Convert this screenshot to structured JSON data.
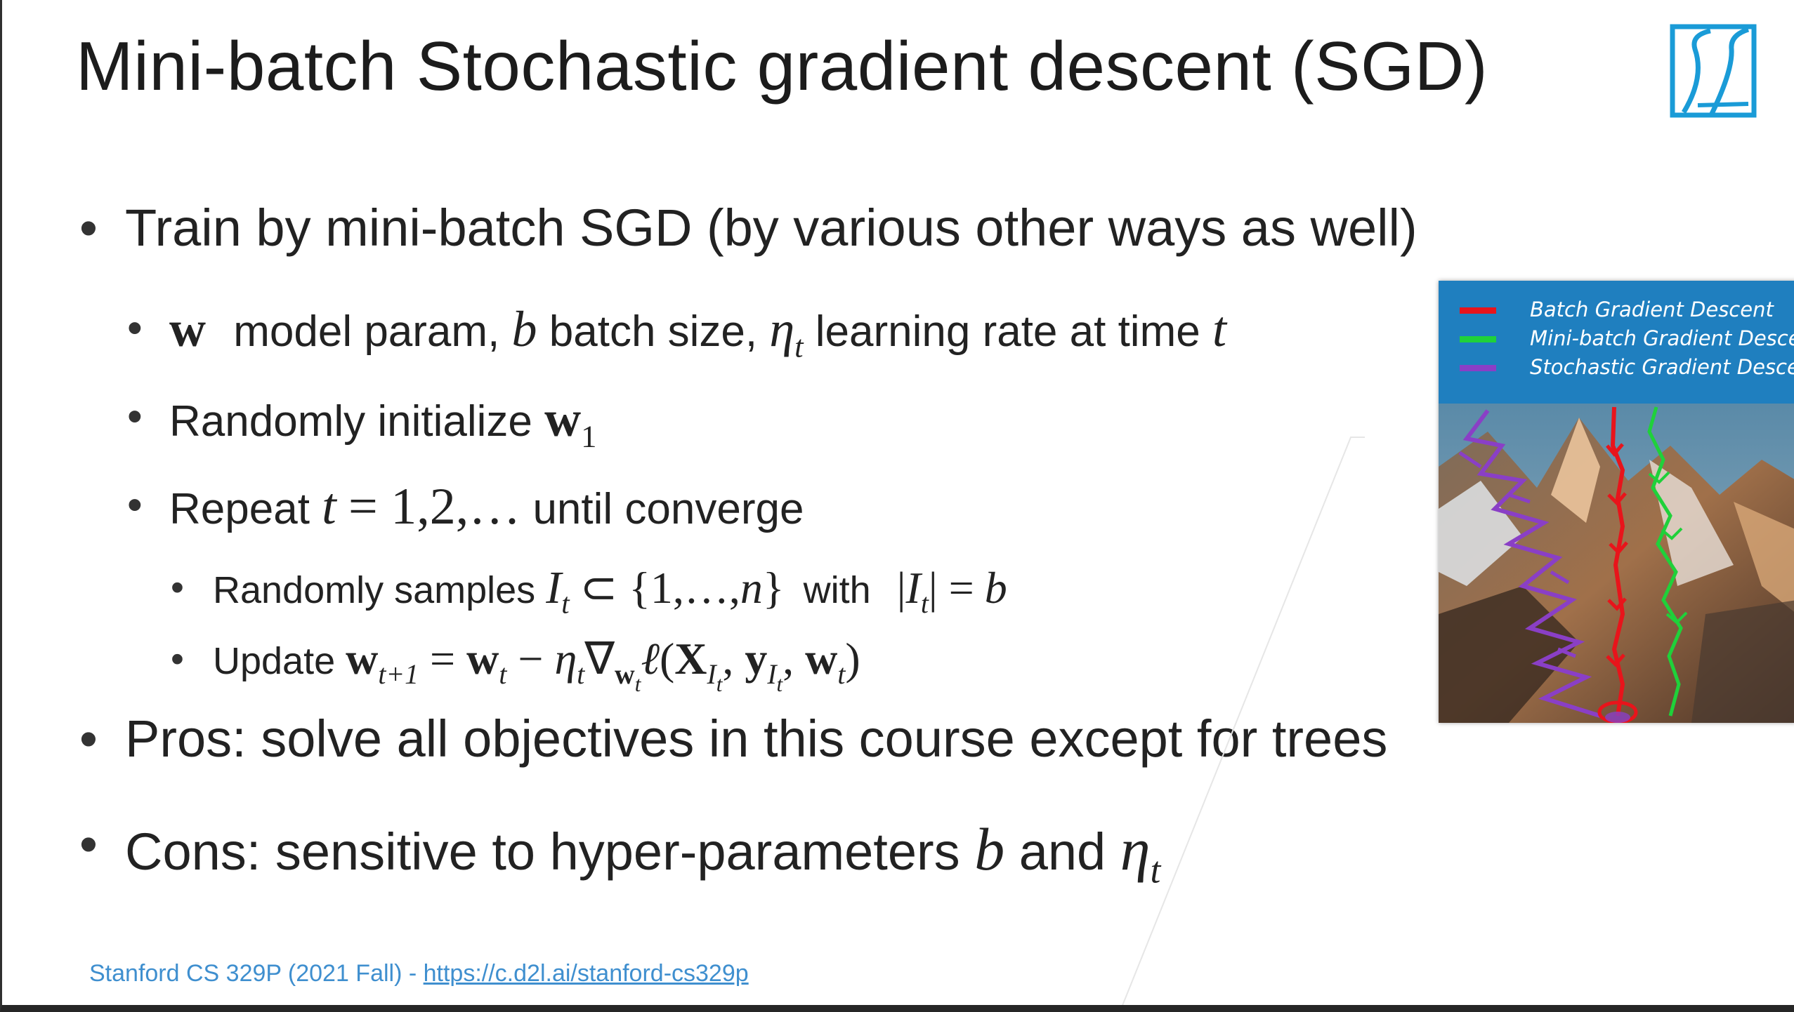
{
  "title": "Mini-batch Stochastic gradient descent (SGD)",
  "bullets": {
    "b1": "Train by mini-batch SGD (by various other ways as well)",
    "b1_1": {
      "w": "w",
      "t1": "model param,",
      "b": "b",
      "t2": "batch size,",
      "eta": "η",
      "t": "t",
      "t3": "learning rate at time",
      "t_end": "t"
    },
    "b1_2": {
      "text": "Randomly initialize",
      "w": "w",
      "sub": "1"
    },
    "b1_3": {
      "t1": "Repeat",
      "t": "t",
      "eq": "= 1,2,…",
      "t2": "until converge"
    },
    "b1_3_1": {
      "t1": "Randomly samples",
      "I": "I",
      "t": "t",
      "set": "⊂ {1,…,",
      "n": "n",
      "close": "}",
      "t2": "with",
      "abs": "|",
      "abs2": "| =",
      "b": "b"
    },
    "b1_3_2": {
      "t1": "Update",
      "lhs_sub": "t+1",
      "rhs_sub": "t",
      "eta_sub": "t",
      "grad_sub": "w",
      "grad_subsub": "t",
      "X": "X",
      "y": "y",
      "I": "I",
      "Isub": "t",
      "w_end_sub": "t"
    },
    "b2": "Pros: solve all objectives in this course except for trees",
    "b3": {
      "text": "Cons: sensitive to hyper-parameters",
      "b": "b",
      "and": "and",
      "eta": "η",
      "t": "t"
    }
  },
  "figure": {
    "legend": [
      {
        "label": "Batch Gradient Descent",
        "color": "#e8141b"
      },
      {
        "label": "Mini-batch Gradient Descent",
        "color": "#1fd13a"
      },
      {
        "label": "Stochastic Gradient Descent",
        "color": "#8a3fc6"
      }
    ]
  },
  "footer": {
    "text": "Stanford CS 329P (2021 Fall) - ",
    "link": "https://c.d2l.ai/stanford-cs329p"
  },
  "colors": {
    "accent": "#3f8fcf",
    "logo": "#1a9bd7"
  }
}
